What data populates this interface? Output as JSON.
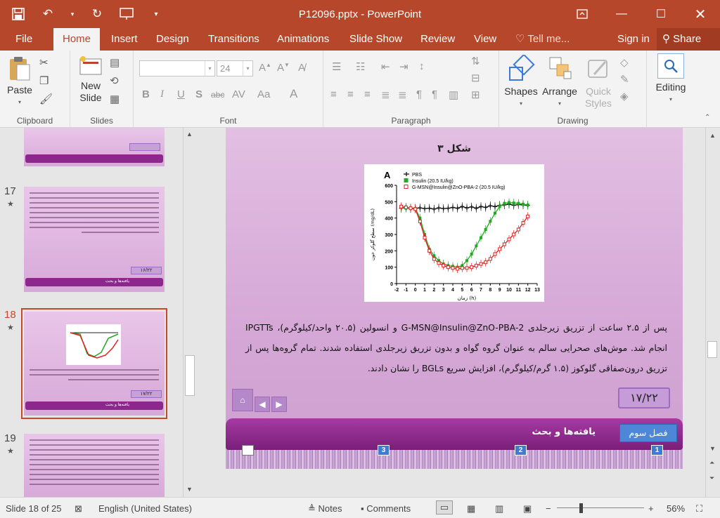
{
  "window": {
    "title": "P12096.pptx - PowerPoint"
  },
  "tabs": [
    {
      "label": "File"
    },
    {
      "label": "Home"
    },
    {
      "label": "Insert"
    },
    {
      "label": "Design"
    },
    {
      "label": "Transitions"
    },
    {
      "label": "Animations"
    },
    {
      "label": "Slide Show"
    },
    {
      "label": "Review"
    },
    {
      "label": "View"
    }
  ],
  "tell_me": "Tell me...",
  "sign_in": "Sign in",
  "share": "Share",
  "ribbon": {
    "clipboard": {
      "paste": "Paste",
      "label": "Clipboard"
    },
    "slides": {
      "new_slide_1": "New",
      "new_slide_2": "Slide",
      "label": "Slides"
    },
    "font": {
      "size": "24",
      "label": "Font"
    },
    "paragraph": {
      "label": "Paragraph"
    },
    "drawing": {
      "shapes": "Shapes",
      "arrange": "Arrange",
      "quick_1": "Quick",
      "quick_2": "Styles",
      "label": "Drawing"
    },
    "editing": {
      "label": "Editing"
    }
  },
  "thumbnails": [
    {
      "num": "17",
      "page": "۱۶/۲۲",
      "footer": "یافته‌ها و بحث"
    },
    {
      "num": "18",
      "page": "۱۷/۲۲",
      "footer": "یافته‌ها و بحث"
    },
    {
      "num": "19"
    }
  ],
  "slide": {
    "caption": "شکل ۳",
    "body": "پس از ۲.۵ ساعت از تزریق زیرجلدی G-MSN@Insulin@ZnO-PBA-2 و انسولین (۲۰.۵ واحد/کیلوگرم)، IPGTTs انجام شد. موش‌های صحرایی سالم به عنوان گروه گواه و بدون تزریق زیرجلدی استفاده شدند. تمام گروه‌ها پس از تزریق درون‌صفاقی گلوکوز (۱.۵ گرم/کیلوگرم)، افزایش سریع BGLs را نشان دادند.",
    "page_number": "۱۷/۲۲",
    "chapter_button": "فصل سوم",
    "chapter_title": "یافته‌ها و بحث",
    "markers": [
      "1",
      "2",
      "3"
    ]
  },
  "chart_data": {
    "type": "line",
    "panel_label": "A",
    "xlabel": "زمان (h)",
    "ylabel": "سطح گلوکز خون (mg/dL)",
    "xlim": [
      -2,
      13
    ],
    "ylim": [
      0,
      600
    ],
    "x_ticks": [
      "-2",
      "-1",
      "0",
      "1",
      "2",
      "3",
      "4",
      "5",
      "6",
      "7",
      "8",
      "9",
      "10",
      "11",
      "12",
      "13"
    ],
    "y_ticks": [
      "0",
      "100",
      "200",
      "300",
      "400",
      "500",
      "600"
    ],
    "x": [
      -1.5,
      -1,
      -0.5,
      0,
      0.5,
      1,
      1.5,
      2,
      2.5,
      3,
      3.5,
      4,
      4.5,
      5,
      5.5,
      6,
      6.5,
      7,
      7.5,
      8,
      8.5,
      9,
      9.5,
      10,
      10.5,
      11,
      11.5,
      12
    ],
    "series": [
      {
        "name": "PBS",
        "color": "#111111",
        "values": [
          460,
          465,
          458,
          460,
          462,
          458,
          460,
          455,
          462,
          458,
          460,
          465,
          460,
          470,
          462,
          468,
          460,
          470,
          465,
          475,
          470,
          478,
          480,
          485,
          478,
          482,
          480,
          478
        ]
      },
      {
        "name": "Insulin (20.5 IU/kg)",
        "color": "#22aa22",
        "values": [
          465,
          460,
          462,
          458,
          400,
          300,
          210,
          170,
          140,
          120,
          110,
          105,
          100,
          110,
          140,
          180,
          230,
          280,
          330,
          380,
          430,
          470,
          490,
          495,
          492,
          490,
          485,
          480
        ]
      },
      {
        "name": "G-MSN@Insulin@ZnO-PBA-2 (20.5 IU/kg)",
        "color": "#dd2222",
        "values": [
          470,
          465,
          460,
          455,
          380,
          280,
          200,
          150,
          125,
          110,
          100,
          95,
          90,
          95,
          95,
          100,
          110,
          120,
          130,
          150,
          180,
          210,
          240,
          270,
          300,
          330,
          370,
          410
        ]
      }
    ]
  },
  "status": {
    "slide_of": "Slide 18 of 25",
    "language": "English (United States)",
    "notes": "Notes",
    "comments": "Comments",
    "zoom": "56%"
  }
}
